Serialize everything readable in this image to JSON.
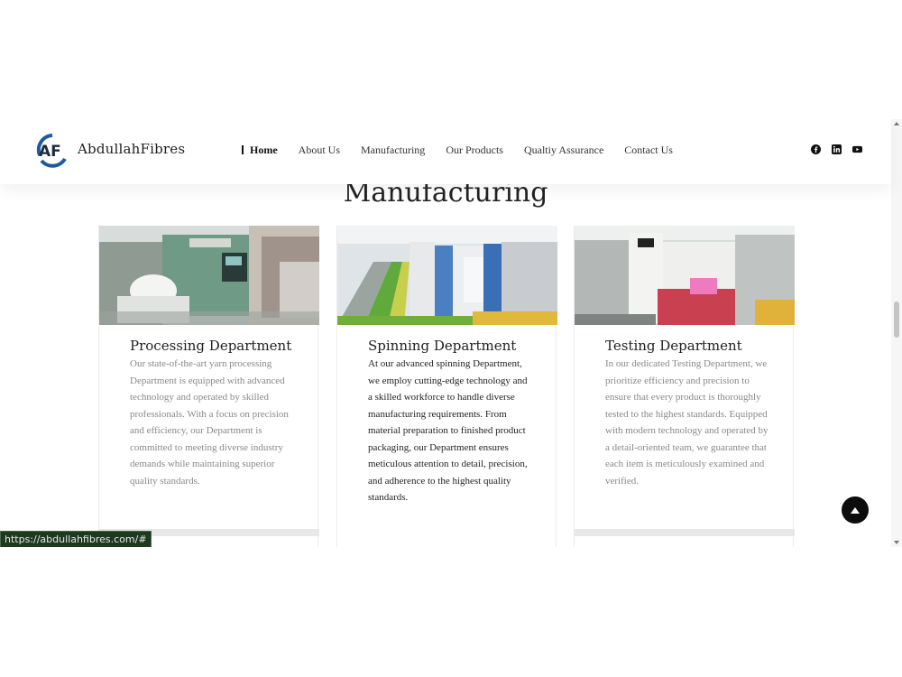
{
  "site": {
    "brand": "AbdullahFibres",
    "logo_letters": "AF"
  },
  "nav": {
    "items": [
      {
        "label": "Home",
        "active": true
      },
      {
        "label": "About Us"
      },
      {
        "label": "Manufacturing"
      },
      {
        "label": "Our Products"
      },
      {
        "label": "Qualtiy Assurance"
      },
      {
        "label": "Contact Us"
      }
    ]
  },
  "socials": [
    "facebook-icon",
    "linkedin-icon",
    "youtube-icon"
  ],
  "section": {
    "title": "Manufacturing"
  },
  "cards": [
    {
      "title": "Processing Department",
      "text": "Our state-of-the-art yarn processing Department is equipped with advanced technology and operated by skilled professionals. With a focus on precision and efficiency, our Department is committed to meeting diverse industry demands while maintaining superior quality standards."
    },
    {
      "title": "Spinning Department",
      "text": "At our advanced spinning Department, we employ cutting-edge technology and a skilled workforce to handle diverse manufacturing requirements. From material preparation to finished product packaging, our Department ensures meticulous attention to detail, precision, and adherence to the highest quality standards."
    },
    {
      "title": "Testing Department",
      "text": "In our dedicated Testing Department, we prioritize efficiency and precision to ensure that every product is thoroughly tested to the highest standards. Equipped with modern technology and operated by a detail-oriented team, we guarantee that each item is meticulously examined and verified."
    }
  ],
  "status_bar": {
    "url": "https://abdullahfibres.com/#"
  },
  "colors": {
    "logo_blue": "#1c5a9c",
    "logo_dark": "#1d2b3a",
    "text_muted": "#888888"
  }
}
